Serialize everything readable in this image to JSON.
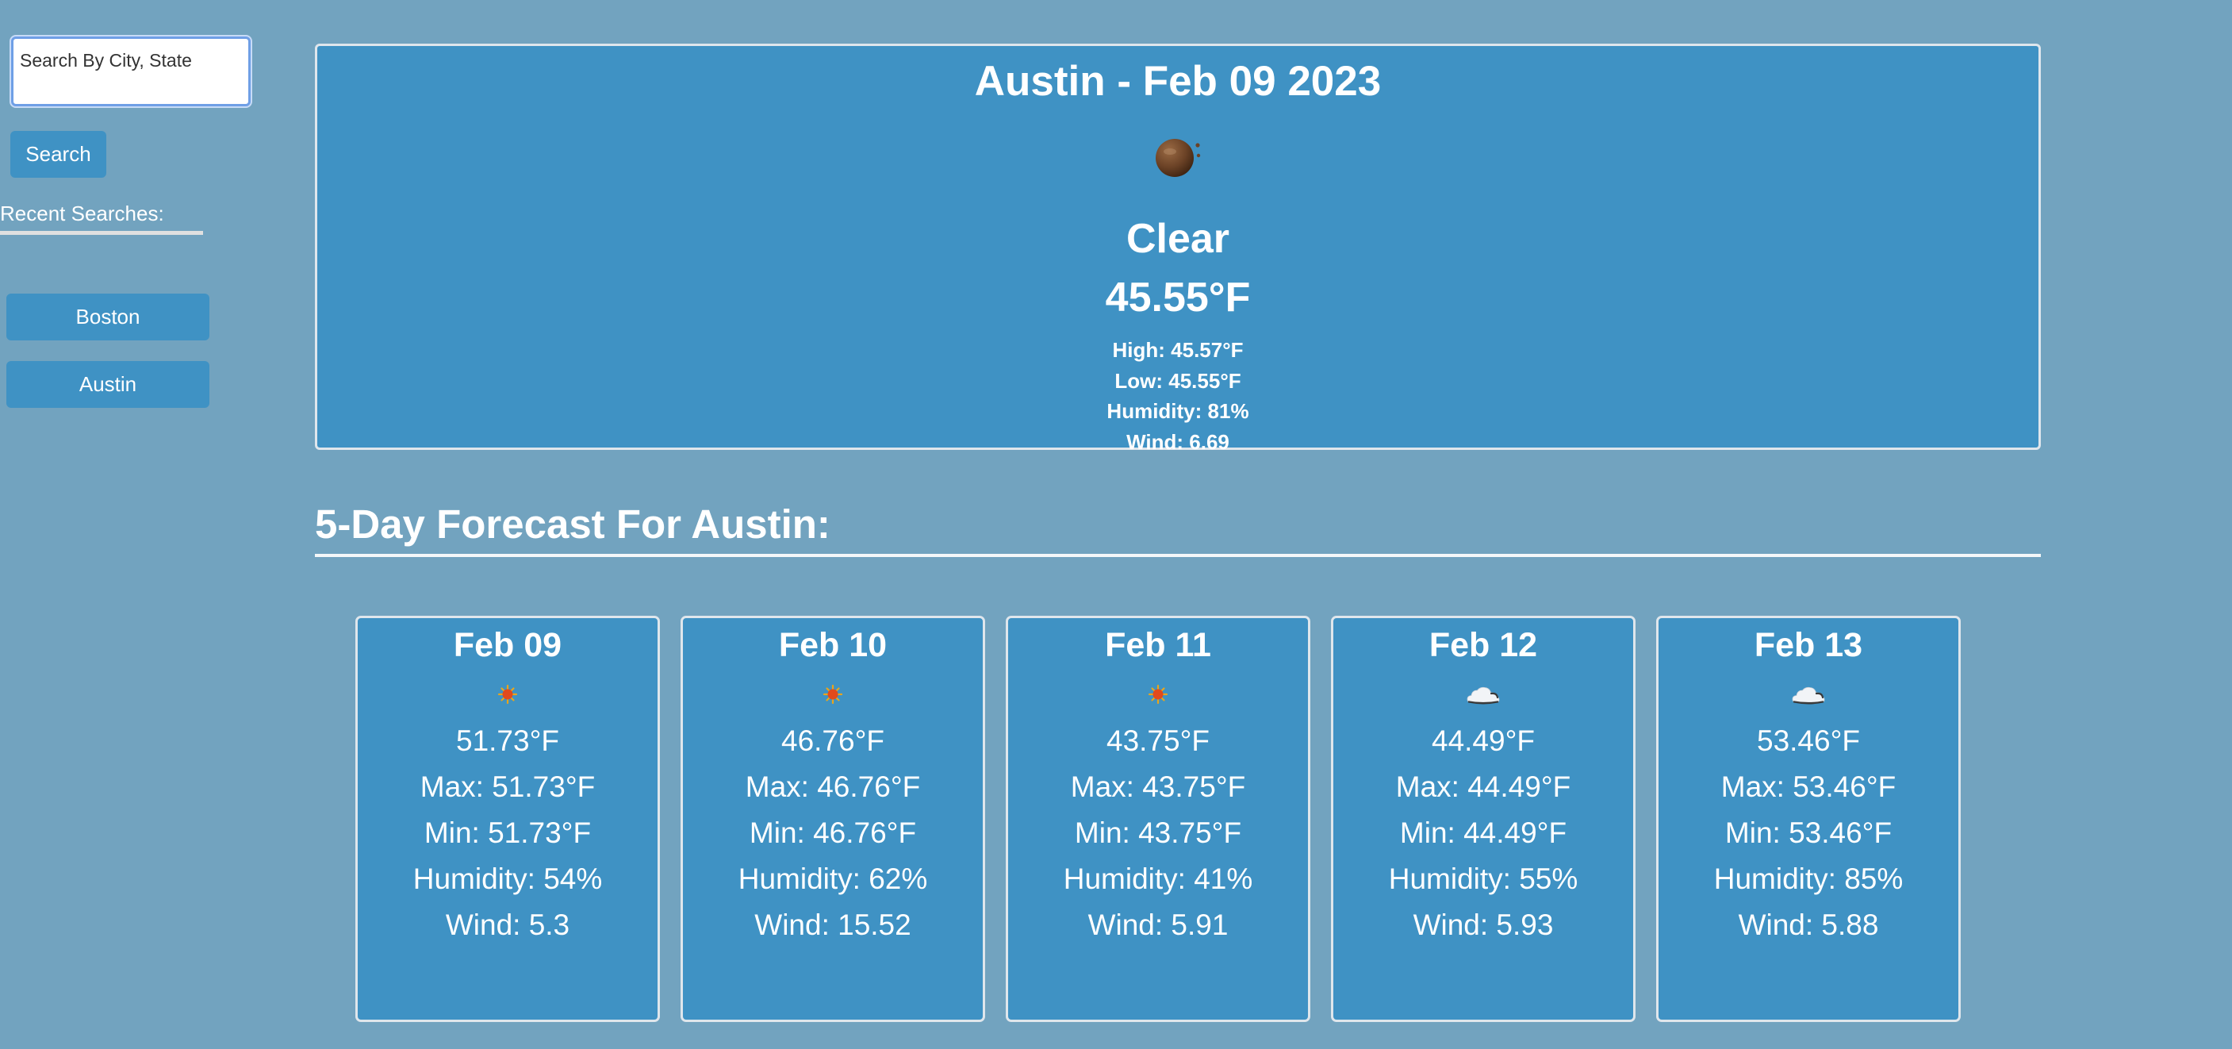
{
  "search": {
    "placeholder": "Search By City, State",
    "button_label": "Search"
  },
  "recent": {
    "heading": "Recent Searches:",
    "items": [
      "Boston",
      "Austin"
    ]
  },
  "current": {
    "title": "Austin - Feb 09 2023",
    "icon": "clear-night-moon-icon",
    "description": "Clear",
    "temperature": "45.55°F",
    "high": "High: 45.57°F",
    "low": "Low: 45.55°F",
    "humidity": "Humidity: 81%",
    "wind": "Wind: 6.69"
  },
  "forecast": {
    "heading": "5-Day Forecast For Austin:",
    "days": [
      {
        "date": "Feb 09",
        "icon": "sun-icon",
        "temp": "51.73°F",
        "max": "Max: 51.73°F",
        "min": "Min: 51.73°F",
        "humidity": "Humidity: 54%",
        "wind": "Wind: 5.3"
      },
      {
        "date": "Feb 10",
        "icon": "sun-icon",
        "temp": "46.76°F",
        "max": "Max: 46.76°F",
        "min": "Min: 46.76°F",
        "humidity": "Humidity: 62%",
        "wind": "Wind: 15.52"
      },
      {
        "date": "Feb 11",
        "icon": "sun-icon",
        "temp": "43.75°F",
        "max": "Max: 43.75°F",
        "min": "Min: 43.75°F",
        "humidity": "Humidity: 41%",
        "wind": "Wind: 5.91"
      },
      {
        "date": "Feb 12",
        "icon": "cloud-icon",
        "temp": "44.49°F",
        "max": "Max: 44.49°F",
        "min": "Min: 44.49°F",
        "humidity": "Humidity: 55%",
        "wind": "Wind: 5.93"
      },
      {
        "date": "Feb 13",
        "icon": "cloud-icon",
        "temp": "53.46°F",
        "max": "Max: 53.46°F",
        "min": "Min: 53.46°F",
        "humidity": "Humidity: 85%",
        "wind": "Wind: 5.88"
      }
    ]
  },
  "colors": {
    "page_background": "#72a3bf",
    "card_background": "#3f92c4",
    "sun": "#e24a1c",
    "moon": "#6b4226"
  }
}
